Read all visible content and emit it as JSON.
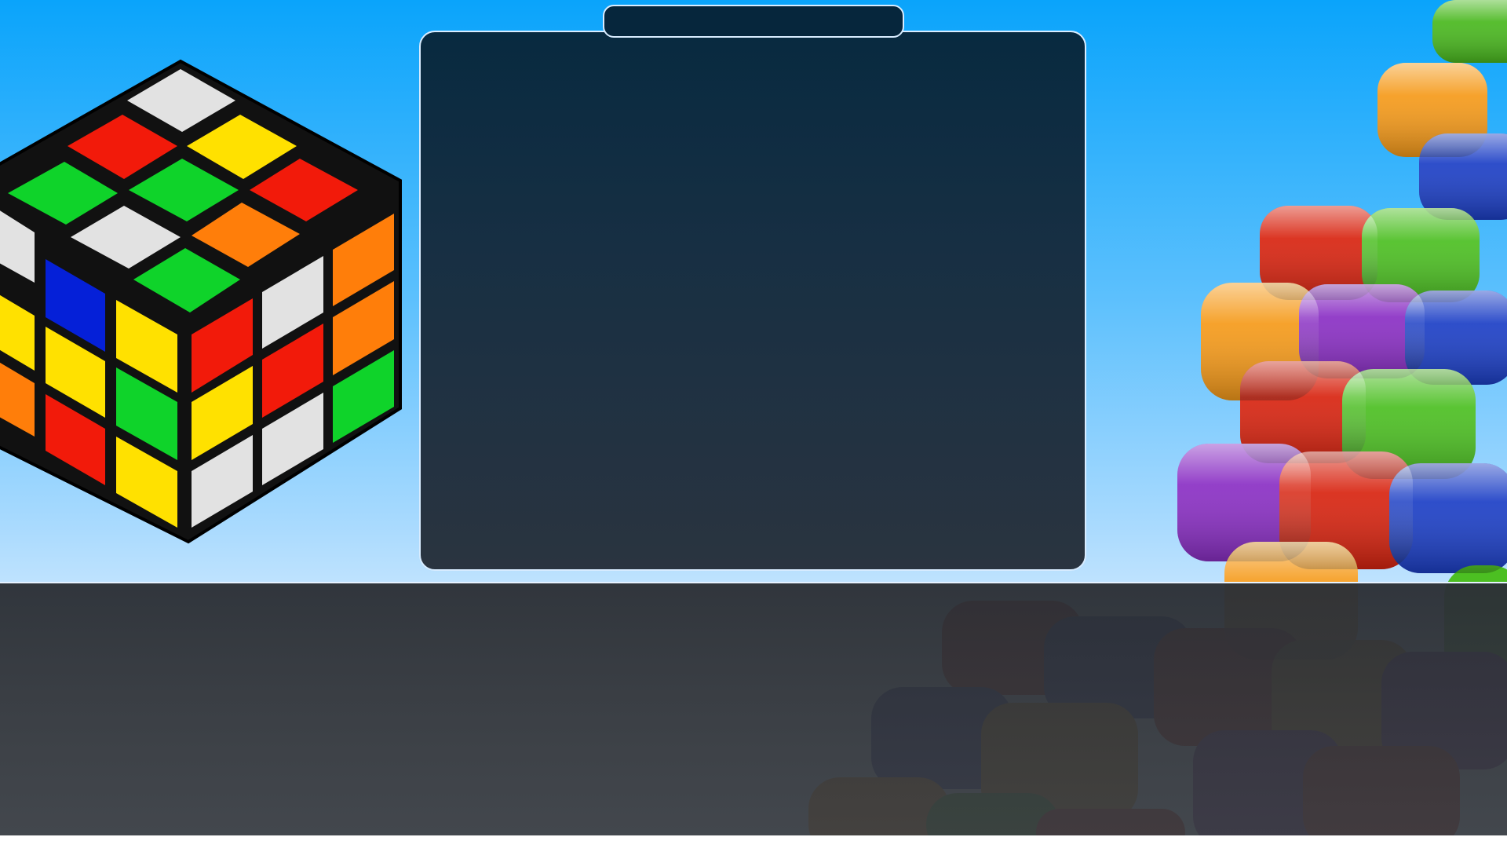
{
  "scene": {
    "background": "sky-gradient",
    "decorations": [
      "rubiks-cube",
      "glossy-cube-wall"
    ]
  },
  "panel": {
    "title": ""
  },
  "tray": {
    "label": ""
  },
  "colors": {
    "sky_top": "#0aa4fb",
    "sky_bottom": "#cfe9ff",
    "panel_dark": "#082a40",
    "tray_dark": "#2c3036",
    "cube_red": "#f21a0a",
    "cube_green": "#0fd32a",
    "cube_yellow": "#ffe100",
    "cube_orange": "#ff7e0a",
    "cube_blue": "#0520d8",
    "cube_white": "#e4e4e4"
  }
}
